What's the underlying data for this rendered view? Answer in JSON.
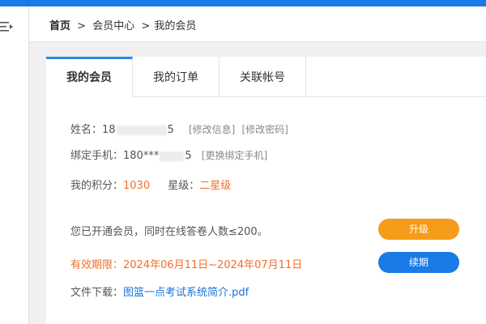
{
  "breadcrumb": {
    "home": "首页",
    "sep1": ">",
    "member_center": "会员中心",
    "sep2": ">",
    "current": "我的会员"
  },
  "tabs": [
    {
      "label": "我的会员",
      "active": true
    },
    {
      "label": "我的订单",
      "active": false
    },
    {
      "label": "关联帐号",
      "active": false
    }
  ],
  "profile": {
    "name_label": "姓名：",
    "name_prefix": "18",
    "name_suffix": "5",
    "edit_info": "[修改信息]",
    "edit_password": "[修改密码]",
    "phone_label": "绑定手机：",
    "phone_prefix": "180***",
    "phone_suffix": "5",
    "change_phone": "[更换绑定手机]",
    "points_label": "我的积分：",
    "points_value": "1030",
    "level_label": "星级：",
    "level_value": "二星级"
  },
  "membership": {
    "status_text": "您已开通会员，同时在线答卷人数≤200。",
    "upgrade_button": "升级",
    "validity_text": "有效期限：2024年06月11日~2024年07月11日",
    "renew_button": "续期",
    "download_label": "文件下载：",
    "download_link": "图篮一点考试系统简介.pdf"
  },
  "colors": {
    "top_bar": "#1a7ae6",
    "accent_orange": "#f0702a",
    "upgrade_button": "#f59c1a",
    "renew_button": "#1a7ae6",
    "link_blue": "#1a73d9",
    "active_tab_border": "#2a86e8"
  },
  "icons": {
    "menu": "menu-collapse-icon"
  }
}
